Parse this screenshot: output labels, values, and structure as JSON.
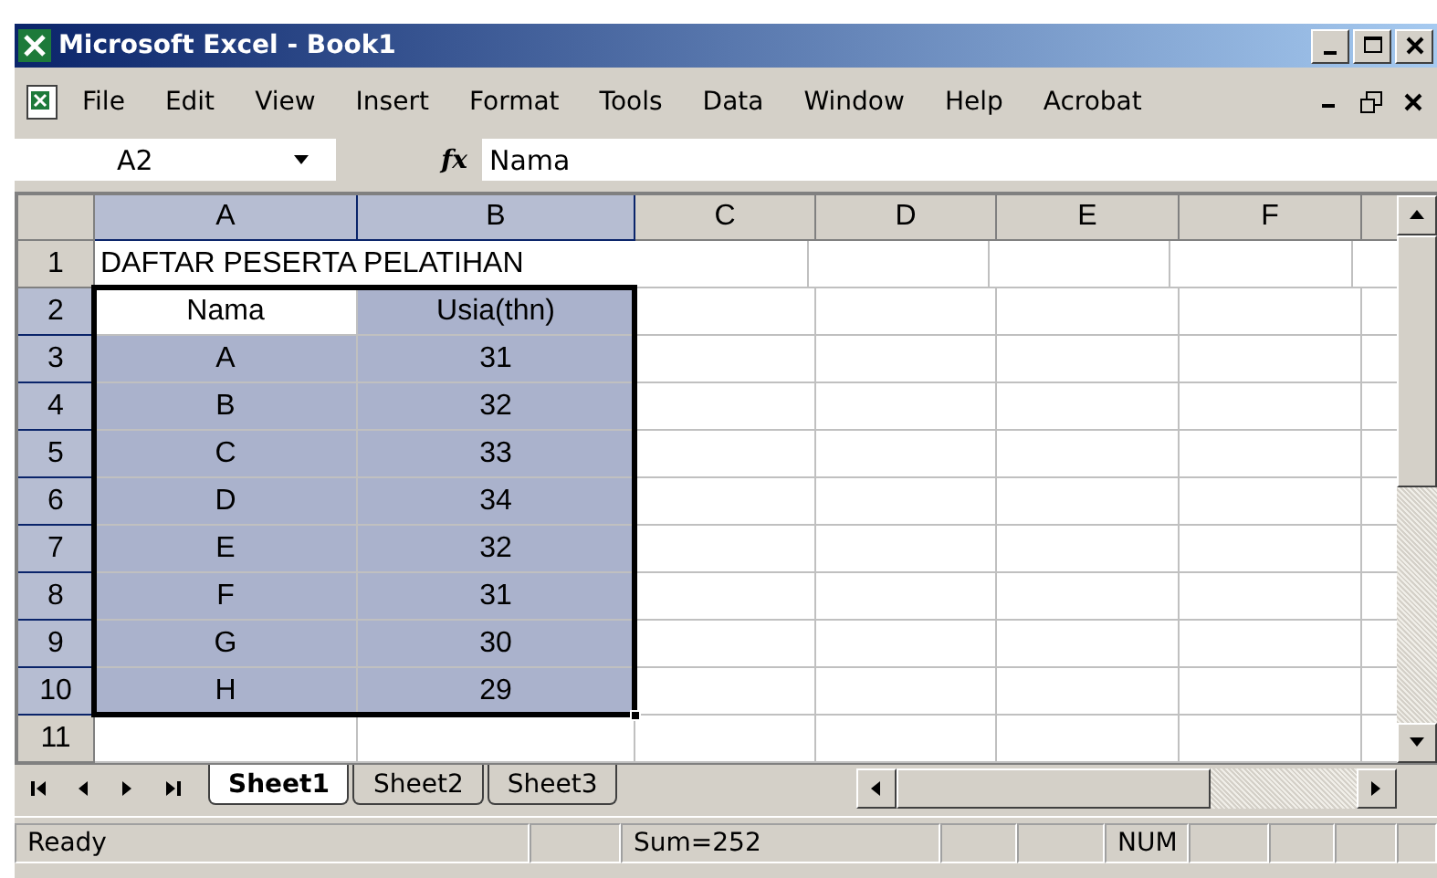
{
  "window": {
    "title": "Microsoft Excel - Book1"
  },
  "menu": {
    "items": [
      "File",
      "Edit",
      "View",
      "Insert",
      "Format",
      "Tools",
      "Data",
      "Window",
      "Help",
      "Acrobat"
    ]
  },
  "name_box": {
    "value": "A2"
  },
  "formula_bar": {
    "fx": "fx",
    "value": "Nama"
  },
  "sheet": {
    "columns": [
      {
        "label": "A",
        "selected": true
      },
      {
        "label": "B",
        "selected": true
      },
      {
        "label": "C",
        "selected": false
      },
      {
        "label": "D",
        "selected": false
      },
      {
        "label": "E",
        "selected": false
      },
      {
        "label": "F",
        "selected": false
      }
    ],
    "rows": [
      {
        "label": "1",
        "selected": false,
        "cells": [
          {
            "kind": "title",
            "value": "DAFTAR PESERTA PELATIHAN",
            "active": false
          }
        ]
      },
      {
        "label": "2",
        "selected": true,
        "cells": [
          {
            "kind": "data",
            "value": "Nama",
            "active": true
          },
          {
            "kind": "data",
            "value": "Usia(thn)",
            "active": false
          }
        ]
      },
      {
        "label": "3",
        "selected": true,
        "cells": [
          {
            "kind": "data",
            "value": "A",
            "active": false
          },
          {
            "kind": "data",
            "value": "31",
            "active": false
          }
        ]
      },
      {
        "label": "4",
        "selected": true,
        "cells": [
          {
            "kind": "data",
            "value": "B",
            "active": false
          },
          {
            "kind": "data",
            "value": "32",
            "active": false
          }
        ]
      },
      {
        "label": "5",
        "selected": true,
        "cells": [
          {
            "kind": "data",
            "value": "C",
            "active": false
          },
          {
            "kind": "data",
            "value": "33",
            "active": false
          }
        ]
      },
      {
        "label": "6",
        "selected": true,
        "cells": [
          {
            "kind": "data",
            "value": "D",
            "active": false
          },
          {
            "kind": "data",
            "value": "34",
            "active": false
          }
        ]
      },
      {
        "label": "7",
        "selected": true,
        "cells": [
          {
            "kind": "data",
            "value": "E",
            "active": false
          },
          {
            "kind": "data",
            "value": "32",
            "active": false
          }
        ]
      },
      {
        "label": "8",
        "selected": true,
        "cells": [
          {
            "kind": "data",
            "value": "F",
            "active": false
          },
          {
            "kind": "data",
            "value": "31",
            "active": false
          }
        ]
      },
      {
        "label": "9",
        "selected": true,
        "cells": [
          {
            "kind": "data",
            "value": "G",
            "active": false
          },
          {
            "kind": "data",
            "value": "30",
            "active": false
          }
        ]
      },
      {
        "label": "10",
        "selected": true,
        "cells": [
          {
            "kind": "data",
            "value": "H",
            "active": false
          },
          {
            "kind": "data",
            "value": "29",
            "active": false
          }
        ]
      },
      {
        "label": "11",
        "selected": false,
        "cells": []
      }
    ]
  },
  "sheet_tabs": [
    {
      "label": "Sheet1",
      "selected": true
    },
    {
      "label": "Sheet2",
      "selected": false
    },
    {
      "label": "Sheet3",
      "selected": false
    }
  ],
  "status_bar": {
    "mode": "Ready",
    "sum": "Sum=252",
    "indicator": "NUM"
  }
}
